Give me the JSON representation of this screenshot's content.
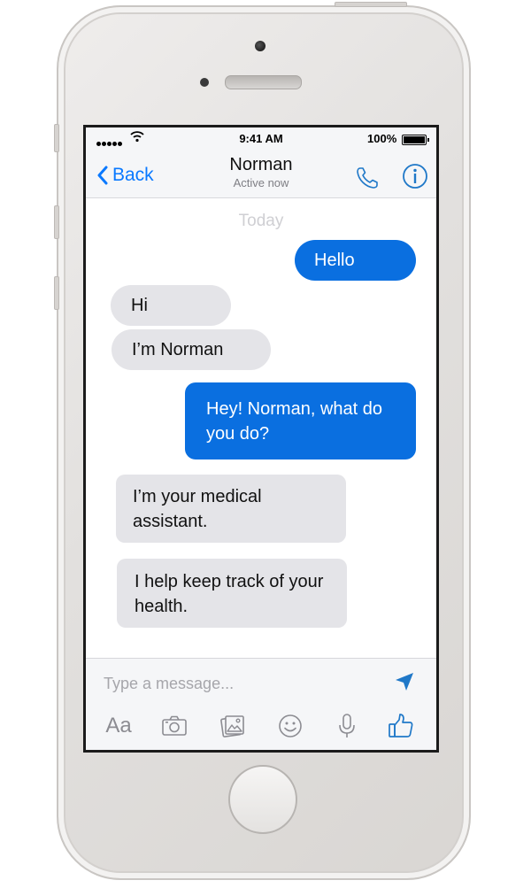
{
  "status_bar": {
    "time": "9:41 AM",
    "battery": "100%"
  },
  "header": {
    "back_label": "Back",
    "contact_name": "Norman",
    "presence": "Active now"
  },
  "conversation": {
    "day_label": "Today",
    "messages": [
      {
        "direction": "outgoing",
        "text": "Hello"
      },
      {
        "direction": "incoming",
        "text": "Hi"
      },
      {
        "direction": "incoming",
        "text": "I’m Norman"
      },
      {
        "direction": "outgoing",
        "text": "Hey! Norman, what do you do?"
      },
      {
        "direction": "incoming",
        "text": "I’m your medical assistant."
      },
      {
        "direction": "incoming",
        "text": "I help keep track of your health."
      }
    ]
  },
  "composer": {
    "placeholder": "Type a message...",
    "text_format_label": "Aa",
    "icons": [
      "send-icon",
      "camera-icon",
      "photo-gallery-icon",
      "emoji-icon",
      "microphone-icon",
      "thumbs-up-icon"
    ]
  },
  "colors": {
    "accent": "#0a79ff",
    "outgoing_bubble": "#0a6fe0",
    "incoming_bubble": "#e4e4e8"
  }
}
